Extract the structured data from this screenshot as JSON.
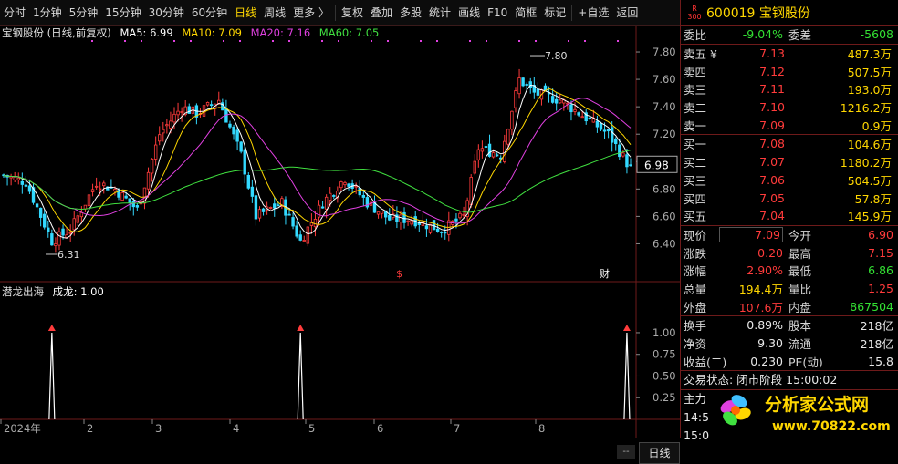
{
  "toolbar": {
    "items": [
      "分时",
      "1分钟",
      "5分钟",
      "15分钟",
      "30分钟",
      "60分钟",
      "日线",
      "周线",
      "更多 〉",
      "复权",
      "叠加",
      "多股",
      "统计",
      "画线",
      "F10",
      "简框",
      "标记",
      "+自选",
      "返回"
    ],
    "active": "日线"
  },
  "kline_legend": {
    "title": "宝钢股份 (日线,前复权)",
    "ma5": "MA5: 6.99",
    "ma10": "MA10: 7.09",
    "ma20": "MA20: 7.16",
    "ma60": "MA60: 7.05"
  },
  "indicator_legend": {
    "name": "潜龙出海",
    "value": "成龙: 1.00"
  },
  "colors": {
    "up": "#ff3b3b",
    "down": "#33d9ff",
    "ma5": "#ffffff",
    "ma10": "#ffd700",
    "ma20": "#e040e0",
    "ma60": "#40e040",
    "border": "#6e1a1a"
  },
  "chart_data": {
    "type": "candlestick",
    "price_axis": [
      "7.80",
      "7.60",
      "7.40",
      "7.20",
      "7.00",
      "6.80",
      "6.60",
      "6.40"
    ],
    "current_price_label": "6.98",
    "high_label": "7.80",
    "low_label": "6.31",
    "markers": [
      "$",
      "财"
    ],
    "indicator_axis": [
      "1.00",
      "0.75",
      "0.50",
      "0.25"
    ],
    "indicator_signals": [
      1,
      1,
      1
    ],
    "x_labels": [
      "2024年",
      "2",
      "3",
      "4",
      "5",
      "6",
      "7",
      "8",
      "--"
    ],
    "ylim": [
      6.25,
      7.9
    ],
    "signal_indices": [
      13,
      80,
      168
    ]
  },
  "stock": {
    "badge_top": "R",
    "badge_bottom": "300",
    "code_name": "600019 宝钢股份"
  },
  "ratio": {
    "l1": "委比",
    "v1": "-9.04%",
    "l2": "委差",
    "v2": "-5608"
  },
  "orderbook": {
    "sell": [
      {
        "label": "卖五 ¥",
        "price": "7.13",
        "vol": "487.3万"
      },
      {
        "label": "卖四",
        "price": "7.12",
        "vol": "507.5万"
      },
      {
        "label": "卖三",
        "price": "7.11",
        "vol": "193.0万"
      },
      {
        "label": "卖二",
        "price": "7.10",
        "vol": "1216.2万"
      },
      {
        "label": "卖一",
        "price": "7.09",
        "vol": "0.9万"
      }
    ],
    "buy": [
      {
        "label": "买一",
        "price": "7.08",
        "vol": "104.6万"
      },
      {
        "label": "买二",
        "price": "7.07",
        "vol": "1180.2万"
      },
      {
        "label": "买三",
        "price": "7.06",
        "vol": "504.5万"
      },
      {
        "label": "买四",
        "price": "7.05",
        "vol": "57.8万"
      },
      {
        "label": "买五",
        "price": "7.04",
        "vol": "145.9万"
      }
    ]
  },
  "quote": [
    {
      "l1": "现价",
      "v1": "7.09",
      "l2": "今开",
      "v2": "6.90"
    },
    {
      "l1": "涨跌",
      "v1": "0.20",
      "l2": "最高",
      "v2": "7.15"
    },
    {
      "l1": "涨幅",
      "v1": "2.90%",
      "l2": "最低",
      "v2": "6.86"
    },
    {
      "l1": "总量",
      "v1": "194.4万",
      "l2": "量比",
      "v2": "1.25"
    },
    {
      "l1": "外盘",
      "v1": "107.6万",
      "l2": "内盘",
      "v2": "867504"
    }
  ],
  "fundamentals": [
    {
      "l1": "换手",
      "v1": "0.89%",
      "l2": "股本",
      "v2": "218亿"
    },
    {
      "l1": "净资",
      "v1": "9.30",
      "l2": "流通",
      "v2": "218亿"
    },
    {
      "l1": "收益(二)",
      "v1": "0.230",
      "l2": "PE(动)",
      "v2": "15.8"
    }
  ],
  "status": "交易状态: 闭市阶段 15:00:02",
  "mainforce": {
    "label": "主力",
    "t1": "14:5",
    "t2": "15:0"
  },
  "logo": {
    "cn": "分析家公式网",
    "url": "www.70822.com"
  },
  "bottom_tab": "日线",
  "dropdown": "--"
}
